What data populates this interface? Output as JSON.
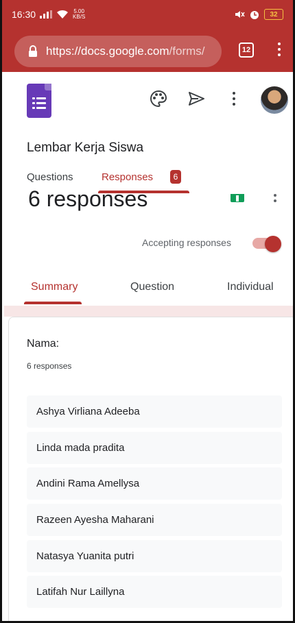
{
  "status_bar": {
    "time": "16:30",
    "network_speed_value": "5.00",
    "network_speed_unit": "KB/S",
    "battery": "32"
  },
  "browser": {
    "url_host": "https://docs.google.com",
    "url_path": "/forms/",
    "tab_count": "12"
  },
  "form": {
    "title": "Lembar Kerja Siswa",
    "tabs": [
      {
        "label": "Questions"
      },
      {
        "label": "Responses",
        "badge": "6"
      }
    ],
    "response_count": "6 responses",
    "accepting_label": "Accepting responses",
    "accepting": true,
    "subtabs": [
      {
        "label": "Summary"
      },
      {
        "label": "Question"
      },
      {
        "label": "Individual"
      }
    ]
  },
  "question": {
    "title": "Nama:",
    "count": "6 responses",
    "answers": [
      "Ashya Virliana Adeeba",
      "Linda mada pradita",
      "Andini Rama Amellysa",
      "Razeen Ayesha Maharani",
      "Natasya Yuanita putri",
      "Latifah Nur Laillyna"
    ]
  },
  "colors": {
    "accent": "#b5322f",
    "forms_purple": "#673ab7",
    "sheets_green": "#0f9d58"
  },
  "icons": [
    "signal-icon",
    "wifi-icon",
    "lock-icon",
    "palette-icon",
    "send-icon",
    "more-vert-icon",
    "sheets-icon",
    "alarm-icon",
    "mute-icon"
  ]
}
